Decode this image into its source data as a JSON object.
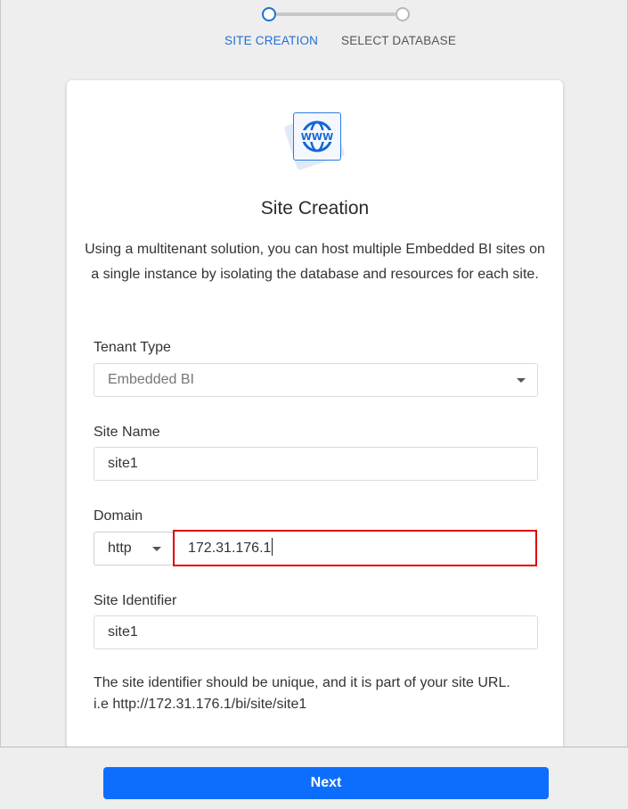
{
  "stepper": {
    "steps": [
      {
        "label": "SITE CREATION",
        "state": "active"
      },
      {
        "label": "SELECT DATABASE",
        "state": "inactive"
      }
    ],
    "active_color": "#1f6fd6"
  },
  "card": {
    "icon": "www-globe-icon",
    "icon_text": "WWW",
    "title": "Site Creation",
    "description": "Using a multitenant solution, you can host multiple Embedded BI sites on a single instance by isolating the database and resources for each site."
  },
  "form": {
    "tenant_type": {
      "label": "Tenant Type",
      "value": "Embedded BI"
    },
    "site_name": {
      "label": "Site Name",
      "value": "site1"
    },
    "domain": {
      "label": "Domain",
      "protocol": "http",
      "value": "172.31.176.1",
      "highlight_color": "#e00000"
    },
    "site_identifier": {
      "label": "Site Identifier",
      "value": "site1"
    },
    "hint_line1": "The site identifier should be unique, and it is part of your site URL.",
    "hint_line2": "i.e http://172.31.176.1/bi/site/site1"
  },
  "footer": {
    "next_label": "Next",
    "button_color": "#0d6efd"
  }
}
